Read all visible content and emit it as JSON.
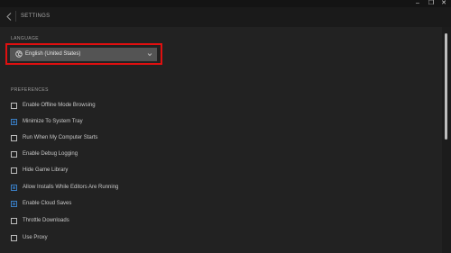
{
  "window": {
    "minimize_glyph": "–",
    "restore_glyph": "❐",
    "close_glyph": "✕"
  },
  "header": {
    "title": "SETTINGS",
    "back_icon": "chevron-left-icon"
  },
  "language": {
    "section_label": "LANGUAGE",
    "selected": "English (United States)",
    "icon": "globe-icon",
    "highlight_color": "#e01010"
  },
  "preferences": {
    "section_label": "PREFERENCES",
    "items": [
      {
        "label": "Enable Offline Mode Browsing",
        "checked": false
      },
      {
        "label": "Minimize To System Tray",
        "checked": true
      },
      {
        "label": "Run When My Computer Starts",
        "checked": false
      },
      {
        "label": "Enable Debug Logging",
        "checked": false
      },
      {
        "label": "Hide Game Library",
        "checked": false
      },
      {
        "label": "Allow Installs While Editors Are Running",
        "checked": true
      },
      {
        "label": "Enable Cloud Saves",
        "checked": true
      },
      {
        "label": "Throttle Downloads",
        "checked": false
      },
      {
        "label": "Use Proxy",
        "checked": false
      }
    ]
  },
  "colors": {
    "background": "#222222",
    "checkbox_checked": "#3b7fc4"
  }
}
